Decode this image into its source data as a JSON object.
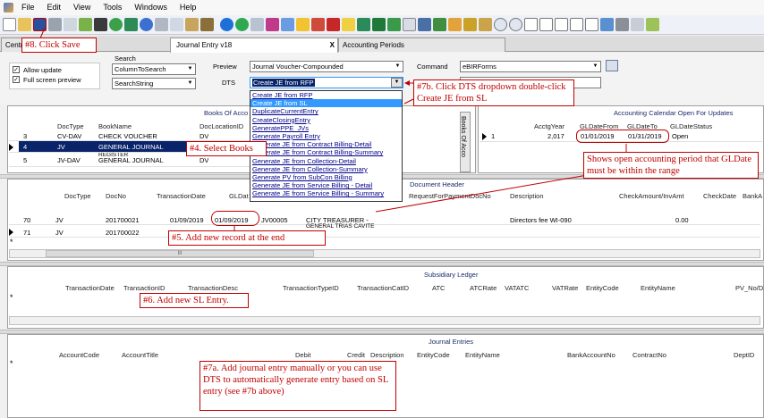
{
  "menu": [
    "File",
    "Edit",
    "View",
    "Tools",
    "Windows",
    "Help"
  ],
  "tabs": [
    "Centr",
    "Journal Entry v18",
    "Accounting Periods"
  ],
  "tab_close": "X",
  "options": {
    "allow_update": "Allow update",
    "full_screen_preview": "Full screen preview"
  },
  "search": {
    "label": "Search",
    "column": "ColumnToSearch",
    "string": "SearchString"
  },
  "preview": {
    "label": "Preview",
    "value": "Journal Voucher-Compounded"
  },
  "dts": {
    "label": "DTS",
    "value": "Create JE from RFP",
    "dropdown_arrow": "▼"
  },
  "command": {
    "label": "Command",
    "value": "eBIRForms"
  },
  "dts_options": [
    "Create JE from RFP",
    "Create JE from SL",
    "DuplicateCurrentEntry",
    "CreateClosingEntry",
    "GeneratePPE_JVs",
    "Generate Payroll Entry",
    "Generate JE from Contract Billing-Detail",
    "Generate JE from Contract Billing-Summary",
    "Generate JE from Collection-Detail",
    "Generate JE from Collection-Summary",
    "Generate PV from SubCon Billing",
    "Generate JE from Service Billing - Detail",
    "Generate JE from Service Billing - Summary"
  ],
  "books": {
    "title": "Books Of Acco",
    "side_title": "Books Of Acco",
    "headers": [
      "DocType",
      "BookName",
      "DocLocationID"
    ],
    "rows": [
      {
        "id": "3",
        "doctype": "CV-DAV",
        "book": "CHECK VOUCHER",
        "loc": "DV"
      },
      {
        "id": "4",
        "doctype": "JV",
        "book": "GENERAL JOURNAL",
        "loc": "DV"
      },
      {
        "id": "5",
        "doctype": "JV-DAV",
        "book": "GENERAL JOURNAL",
        "loc": "DV"
      }
    ],
    "row2_sub": "REGISTER"
  },
  "calendar": {
    "title": "Accounting Calendar Open For Updates",
    "headers": [
      "AcctgYear",
      "GLDateFrom",
      "GLDateTo",
      "GLDateStatus"
    ],
    "row": {
      "id": "1",
      "year": "2,017",
      "from": "01/01/2019",
      "to": "01/31/2019",
      "status": "Open"
    }
  },
  "doc_header": {
    "title": "Document Header",
    "headers": [
      "DocType",
      "DocNo",
      "TransactionDate",
      "GLDat",
      "RequestForPaymentDocNo",
      "Description",
      "CheckAmount/InvAmt",
      "CheckDate",
      "BankA"
    ],
    "rows": [
      {
        "id": "70",
        "doctype": "JV",
        "docno": "201700021",
        "tdate": "01/09/2019",
        "gldate": "01/09/2019",
        "ref": "JV00005",
        "payee": "CITY TREASURER -",
        "desc": "Directors fee WI-090",
        "amt": "0.00"
      },
      {
        "id": "71",
        "doctype": "JV",
        "docno": "201700022",
        "tdate": "",
        "gldate": "",
        "ref": "",
        "payee": "GENERAL TRIAS CAVITE",
        "desc": "",
        "amt": ""
      }
    ],
    "new_row": "*"
  },
  "subsidiary": {
    "title": "Subsidiary Ledger",
    "headers": [
      "TransactionDate",
      "TransactionID",
      "TransactionDesc",
      "TransactionTypeID",
      "TransactionCatID",
      "ATC",
      "ATCRate",
      "VATATC",
      "VATRate",
      "EntityCode",
      "EntityName",
      "PV_No/D"
    ],
    "new_row": "*"
  },
  "journal": {
    "title": "Journal Entries",
    "headers": [
      "AccountCode",
      "AccountTitle",
      "Debit",
      "Credit",
      "Description",
      "EntityCode",
      "EntityName",
      "BankAccountNo",
      "ContractNo",
      "DeptID"
    ],
    "new_row": "*"
  },
  "annotations": {
    "a8": "#8. Click Save",
    "a7b": "#7b. Click DTS dropdown double-click Create JE from SL",
    "a4": "#4. Select Books",
    "a_open": "Shows open accounting period that GLDate must be within the range",
    "a5": "#5. Add new record at the end",
    "a6": "#6. Add new SL Entry.",
    "a7a": "#7a. Add journal entry manually or you can use DTS to automatically generate entry based on SL entry (see #7b above)"
  },
  "scroll_glyph": "III",
  "colors": {
    "annotation": "#c00000",
    "selection": "#0a246a",
    "highlight": "#3399ff"
  }
}
